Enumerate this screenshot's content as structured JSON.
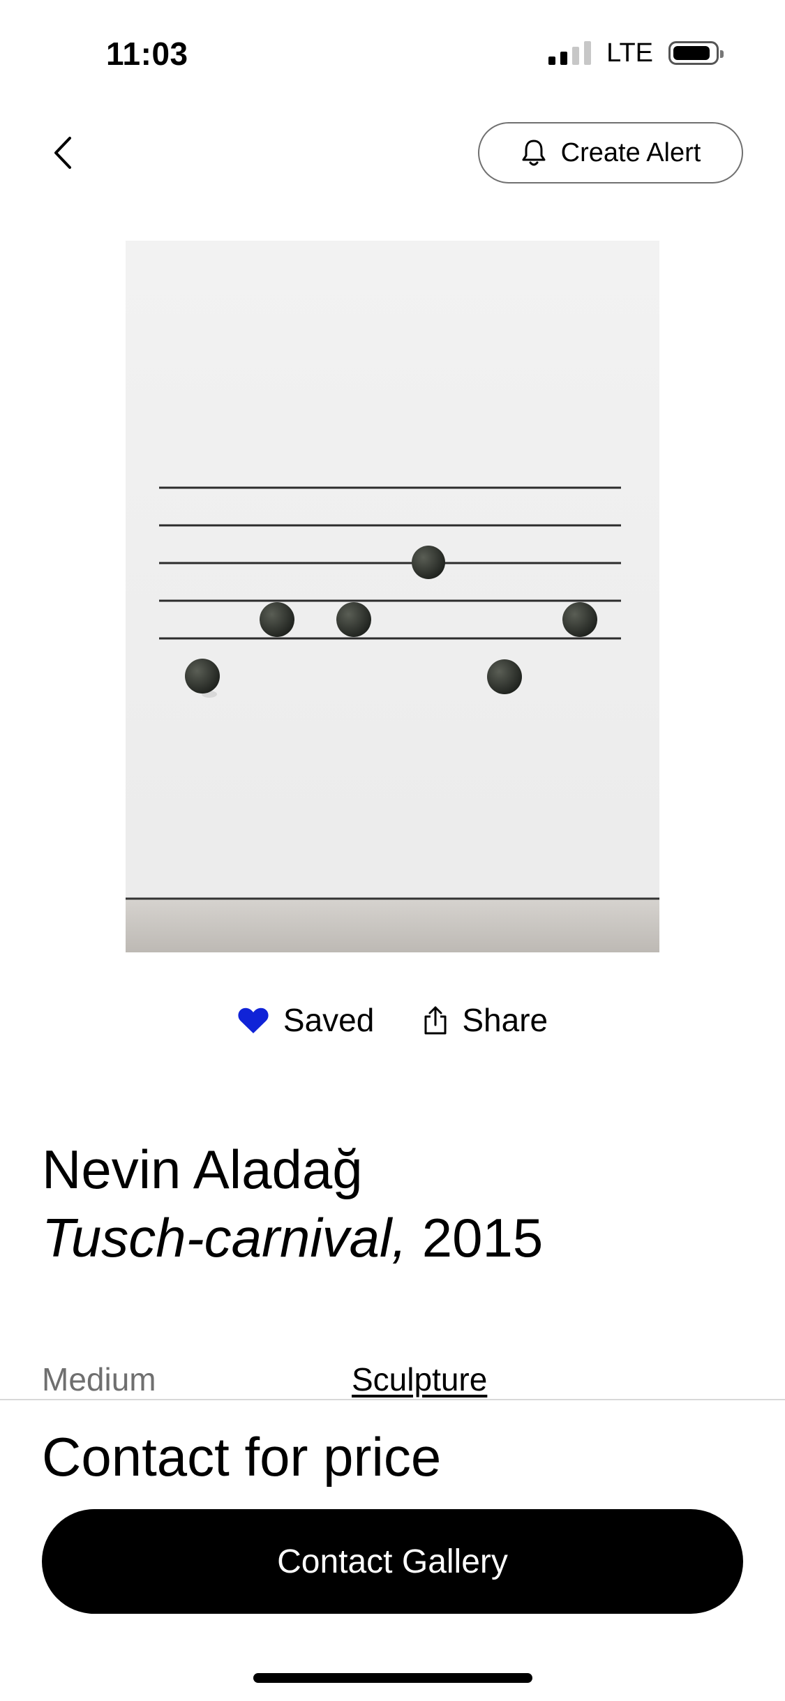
{
  "status_bar": {
    "time": "11:03",
    "network": "LTE",
    "signal_bars": 2,
    "signal_bars_total": 4,
    "battery_level": 0.8
  },
  "header": {
    "back_icon": "chevron-left-icon",
    "alert_icon": "bell-icon",
    "create_alert_label": "Create Alert"
  },
  "actions": {
    "saved_icon": "heart-icon",
    "saved_color": "#1023d7",
    "saved_label": "Saved",
    "share_icon": "share-icon",
    "share_label": "Share"
  },
  "artwork": {
    "artist": "Nevin Aladağ",
    "title": "Tusch-carnival,",
    "year": "2015",
    "details": [
      {
        "label": "Medium",
        "value": "Sculpture"
      }
    ]
  },
  "purchase": {
    "price_text": "Contact for price",
    "contact_button_label": "Contact Gallery"
  }
}
